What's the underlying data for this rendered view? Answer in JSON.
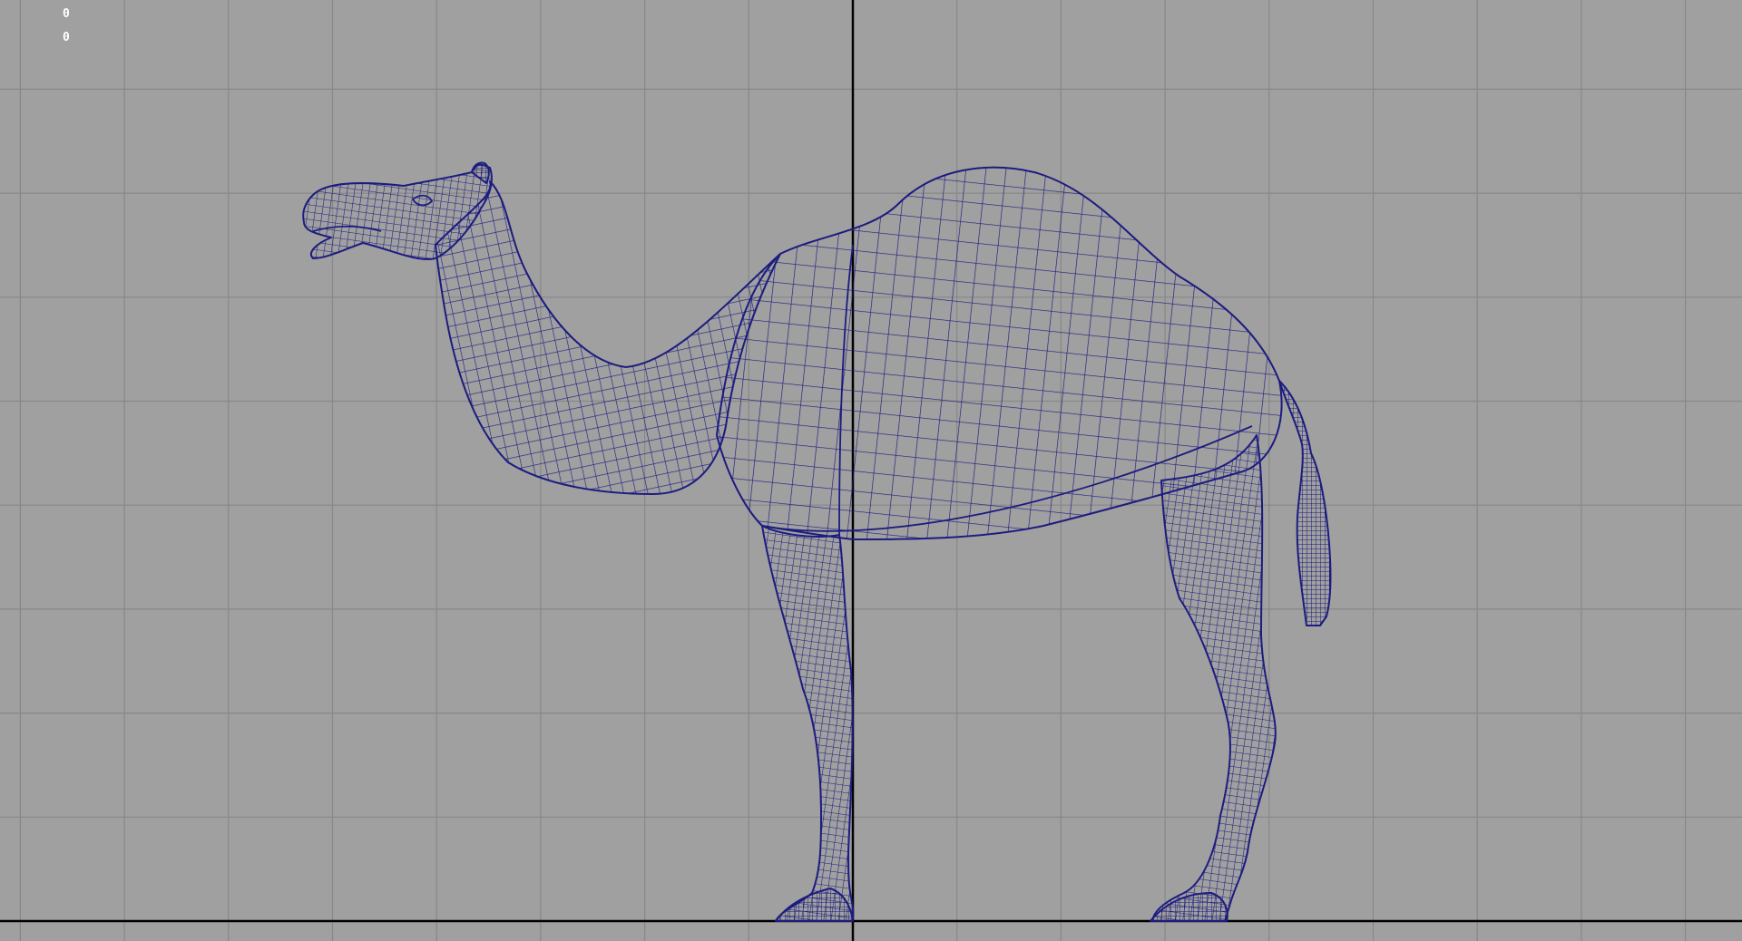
{
  "viewport": {
    "view": "side-orthographic",
    "display_mode": "wireframe",
    "background_color": "#a0a0a0",
    "grid_color": "#808080",
    "axis_color": "#000000",
    "mesh_color": "#1a1a7a",
    "hud": {
      "line_1": "0",
      "line_2": "0"
    },
    "model": {
      "name_icon": "camel-wireframe-mesh"
    }
  }
}
